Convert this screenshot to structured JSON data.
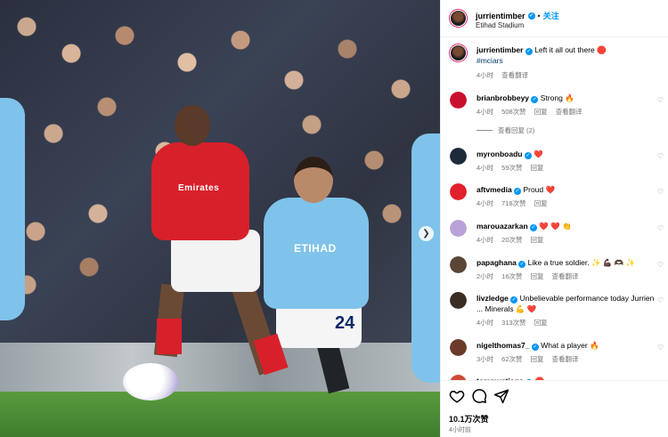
{
  "post": {
    "username": "jurrientimber",
    "follow_label": "关注",
    "location": "Etihad Stadium",
    "caption_text": "Left it all out there 🛑",
    "caption_hashtag": "#mciars",
    "caption_time": "4小时",
    "translate_label": "查看翻译",
    "likes": "10.1万次赞",
    "time": "4小时前"
  },
  "photo": {
    "shirt_sponsor_red": "Emirates",
    "shirt_sponsor_blue": "ETIHAD",
    "shirt_number": "24"
  },
  "comments": [
    {
      "username": "brianbrobbeyy",
      "text": "Strong 🔥",
      "time": "4小时",
      "likes": "508次赞",
      "reply": "回复",
      "translate": "查看翻译",
      "view_replies": "查看回复 (2)"
    },
    {
      "username": "myronboadu",
      "text": "❤️",
      "time": "4小时",
      "likes": "59次赞",
      "reply": "回复"
    },
    {
      "username": "aftvmedia",
      "text": "Proud ❤️",
      "time": "4小时",
      "likes": "718次赞",
      "reply": "回复"
    },
    {
      "username": "marouazarkan",
      "text": "❤️ ❤️ 👏",
      "time": "4小时",
      "likes": "20次赞",
      "reply": "回复"
    },
    {
      "username": "papaghana",
      "text": "Like a true soldier. ✨ 💪🏿 🫶🏿 ✨",
      "time": "2小时",
      "likes": "16次赞",
      "reply": "回复",
      "translate": "查看翻译"
    },
    {
      "username": "livzledge",
      "text": "Unbelievable performance today Jurrien ... Minerals 💪 ❤️",
      "time": "4小时",
      "likes": "313次赞",
      "reply": "回复"
    },
    {
      "username": "nigelthomas7_",
      "text": "What a player 🔥",
      "time": "3小时",
      "likes": "62次赞",
      "reply": "回复",
      "translate": "查看翻译"
    },
    {
      "username": "tommystiago",
      "text": "🛑",
      "time": "",
      "likes": "",
      "reply": ""
    }
  ],
  "colors": {
    "accent": "#0095f6",
    "verified": "#0095f6",
    "heart": "#ed4956",
    "meta": "#737373",
    "arsenal_red": "#d8202b",
    "city_blue": "#7fc3ea"
  },
  "icons": {
    "like": "heart-icon",
    "comment": "comment-icon",
    "share": "share-icon",
    "next": "chevron-right-icon"
  }
}
